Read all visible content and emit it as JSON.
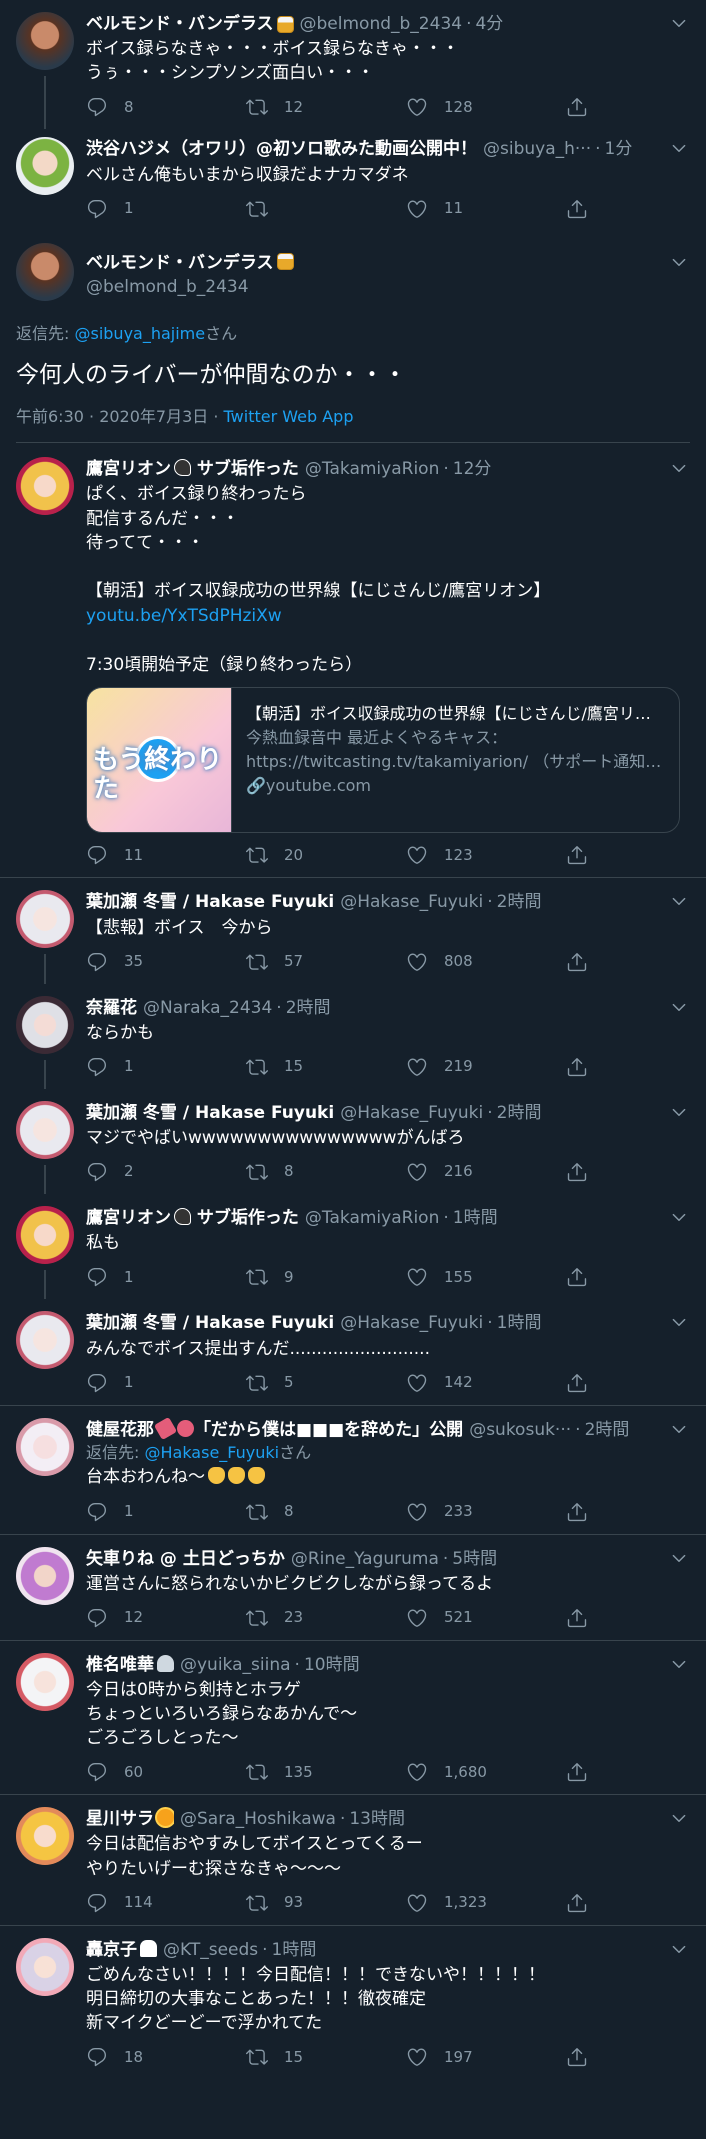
{
  "tweets_top": [
    {
      "name": "ベルモンド・バンデラス",
      "name_emoji": "beer-mug",
      "handle": "@belmond_b_2434",
      "time": "4分",
      "text": "ボイス録らなきゃ・・・ボイス録らなきゃ・・・\nうぅ・・・シンプソンズ面白い・・・",
      "reply": "8",
      "retweet": "12",
      "like": "128"
    },
    {
      "name": "渋谷ハジメ（オワリ）@初ソロ歌みた動画公開中！",
      "handle": "@sibuya_h···",
      "time": "1分",
      "text": "ベルさん俺もいまから収録だよナカマダネ",
      "reply": "1",
      "retweet": "",
      "like": "11"
    }
  ],
  "focal": {
    "name": "ベルモンド・バンデラス",
    "name_emoji": "beer-mug",
    "handle": "@belmond_b_2434",
    "reply_label": "返信先: ",
    "reply_to": "@sibuya_hajime",
    "reply_suffix": "さん",
    "text": "今何人のライバーが仲間なのか・・・",
    "datetime": "午前6:30 · 2020年7月3日 · ",
    "client": "Twitter Web App"
  },
  "rion_main": {
    "name": "鷹宮リオン",
    "name_suffix": " サブ垢作った",
    "handle": "@TakamiyaRion",
    "time": "12分",
    "text1": "ぱく、ボイス録り終わったら\n配信するんだ・・・\n待ってて・・・\n\n【朝活】ボイス収録成功の世界線【にじさんじ/鷹宮リオン】",
    "link": "youtu.be/YxTSdPHziXw",
    "text2": "\n7:30頃開始予定（録り終わったら）",
    "card_title": "【朝活】ボイス収録成功の世界線【にじさんじ/鷹宮リオン】",
    "card_desc": "今熱血録音中 最近よくやるキャス：https://twitcasting.tv/takamiyarion/ （サポート通知…",
    "card_domain": "youtube.com",
    "card_image_text": "もう終わりた",
    "reply": "11",
    "retweet": "20",
    "like": "123"
  },
  "thread2": [
    {
      "name": "葉加瀬 冬雪 / Hakase Fuyuki",
      "handle": "@Hakase_Fuyuki",
      "time": "2時間",
      "text": "【悲報】ボイス　今から",
      "reply": "35",
      "retweet": "57",
      "like": "808"
    },
    {
      "name": "奈羅花",
      "handle": "@Naraka_2434",
      "time": "2時間",
      "text": "ならかも",
      "reply": "1",
      "retweet": "15",
      "like": "219"
    },
    {
      "name": "葉加瀬 冬雪 / Hakase Fuyuki",
      "handle": "@Hakase_Fuyuki",
      "time": "2時間",
      "text": "マジでやばいwwwwwwwwwwwwwwwがんばろ",
      "reply": "2",
      "retweet": "8",
      "like": "216"
    },
    {
      "name": "鷹宮リオン",
      "name_suffix": " サブ垢作った",
      "handle": "@TakamiyaRion",
      "time": "1時間",
      "text": "私も",
      "reply": "1",
      "retweet": "9",
      "like": "155"
    },
    {
      "name": "葉加瀬 冬雪 / Hakase Fuyuki",
      "handle": "@Hakase_Fuyuki",
      "time": "1時間",
      "text": "みんなでボイス提出すんだ..........................",
      "reply": "1",
      "retweet": "5",
      "like": "142"
    }
  ],
  "sukoya": {
    "name": "健屋花那",
    "name_suffix": "「だから僕は■■■を辞めた」公開",
    "handle": "@sukosuk···",
    "time": "2時間",
    "reply_label": "返信先: ",
    "reply_to": "@Hakase_Fuyuki",
    "reply_suffix": "さん",
    "text": "台本おわんね〜",
    "reply": "1",
    "retweet": "8",
    "like": "233"
  },
  "rest": [
    {
      "name": "矢車りね @ 土日どっちか",
      "handle": "@Rine_Yaguruma",
      "time": "5時間",
      "text": "運営さんに怒られないかビクビクしながら録ってるよ",
      "reply": "12",
      "retweet": "23",
      "like": "521"
    },
    {
      "name": "椎名唯華",
      "handle": "@yuika_siina",
      "time": "10時間",
      "text": "今日は0時から剣持とホラゲ\nちょっといろいろ録らなあかんで〜\nごろごろしとった〜",
      "reply": "60",
      "retweet": "135",
      "like": "1,680"
    },
    {
      "name": "星川サラ",
      "handle": "@Sara_Hoshikawa",
      "time": "13時間",
      "text": "今日は配信おやすみしてボイスとってくるー\nやりたいげーむ探さなきゃ〜〜〜",
      "reply": "114",
      "retweet": "93",
      "like": "1,323"
    },
    {
      "name": "轟京子",
      "handle": "@KT_seeds",
      "time": "1時間",
      "text": "ごめんなさい！！！！今日配信！！！できないや！！！！！\n明日締切の大事なことあった！！！徹夜確定\n新マイクどーどーで浮かれてた",
      "reply": "18",
      "retweet": "15",
      "like": "197"
    }
  ],
  "colors": {
    "background": "#15202b",
    "border": "#38444d",
    "secondary_text": "#8899a6",
    "link": "#1da1f2"
  },
  "icons": [
    "reply-icon",
    "retweet-icon",
    "like-icon",
    "share-icon",
    "chevron-down-icon"
  ]
}
